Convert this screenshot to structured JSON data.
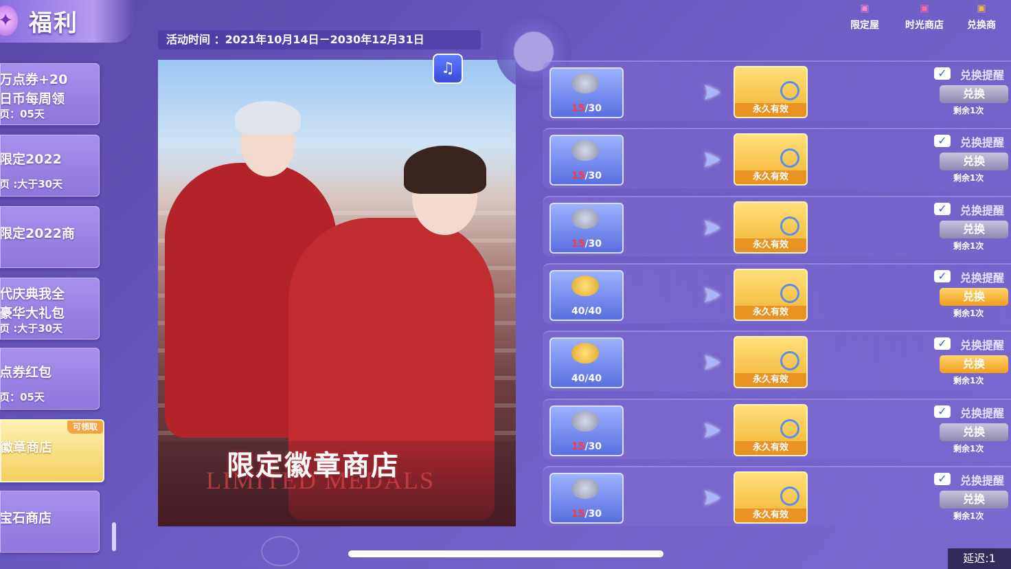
{
  "header": {
    "title": "福利"
  },
  "sidebar": {
    "items": [
      {
        "lines": [
          "万点券+20",
          "日币每周领",
          "页：05天"
        ]
      },
      {
        "lines": [
          "限定2022",
          "",
          "页 :大于30天"
        ]
      },
      {
        "lines": [
          "限定2022商",
          "",
          ""
        ]
      },
      {
        "lines": [
          "代庆典我全",
          "豪华大礼包",
          "页 :大于30天"
        ]
      },
      {
        "lines": [
          "点券红包",
          "",
          "页：05天"
        ]
      },
      {
        "lines": [
          "徽章商店",
          "",
          ""
        ],
        "badge": "可领取",
        "active": true
      },
      {
        "lines": [
          "宝石商店",
          "",
          ""
        ]
      }
    ]
  },
  "event": {
    "time_label": "活动时间 ：2021年10月14日－2030年12月31日"
  },
  "art": {
    "title": "限定徽章商店",
    "subtitle": "LIMITED MEDALS"
  },
  "shops": [
    {
      "label": "限定屋",
      "icon": "limited-house-icon"
    },
    {
      "label": "时光商店",
      "icon": "time-shop-icon"
    },
    {
      "label": "兑换商",
      "icon": "exchange-shop-icon"
    }
  ],
  "rows": [
    {
      "have": "15",
      "need": "/30",
      "coin": "silver",
      "duration": "永久有效",
      "remind": "兑换提醒",
      "button": "兑换",
      "remaining": "剩余1次",
      "enabled": false
    },
    {
      "have": "15",
      "need": "/30",
      "coin": "silver",
      "duration": "永久有效",
      "remind": "兑换提醒",
      "button": "兑换",
      "remaining": "剩余1次",
      "enabled": false
    },
    {
      "have": "15",
      "need": "/30",
      "coin": "silver",
      "duration": "永久有效",
      "remind": "兑换提醒",
      "button": "兑换",
      "remaining": "剩余1次",
      "enabled": false
    },
    {
      "have": "40",
      "need": "/40",
      "coin": "gold",
      "duration": "永久有效",
      "remind": "兑换提醒",
      "button": "兑换",
      "remaining": "剩余1次",
      "enabled": true
    },
    {
      "have": "40",
      "need": "/40",
      "coin": "gold",
      "duration": "永久有效",
      "remind": "兑换提醒",
      "button": "兑换",
      "remaining": "剩余1次",
      "enabled": true
    },
    {
      "have": "15",
      "need": "/30",
      "coin": "silver",
      "duration": "永久有效",
      "remind": "兑换提醒",
      "button": "兑换",
      "remaining": "剩余1次",
      "enabled": false
    },
    {
      "have": "15",
      "need": "/30",
      "coin": "silver",
      "duration": "永久有效",
      "remind": "兑换提醒",
      "button": "兑换",
      "remaining": "剩余1次",
      "enabled": false
    }
  ],
  "status": {
    "delay": "延迟:1"
  },
  "colors": {
    "accent": "#f3cf60",
    "panel": "#8e76dc",
    "alert": "#ff3a3a"
  }
}
